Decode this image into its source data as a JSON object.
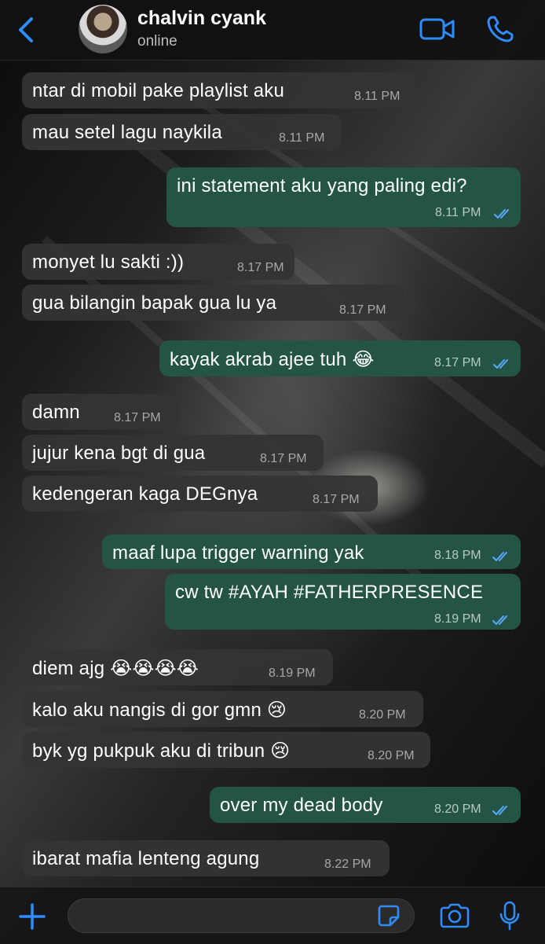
{
  "header": {
    "contact_name": "chalvin cyank",
    "status": "online"
  },
  "colors": {
    "accent": "#2f8cff",
    "incoming_bubble": "#343434",
    "outgoing_bubble": "#235446",
    "read_ticks": "#5aa9ff"
  },
  "messages": [
    {
      "dir": "in",
      "text": "ntar di mobil pake playlist aku",
      "time": "8.11 PM"
    },
    {
      "dir": "in",
      "text": "mau setel lagu naykila",
      "time": "8.11 PM"
    },
    {
      "dir": "out",
      "text": "ini statement aku yang paling edi?",
      "time": "8.11 PM",
      "status": "read"
    },
    {
      "dir": "in",
      "text": "monyet lu sakti :))",
      "time": "8.17 PM"
    },
    {
      "dir": "in",
      "text": "gua bilangin bapak gua lu ya",
      "time": "8.17 PM"
    },
    {
      "dir": "out",
      "text": "kayak akrab ajee tuh 😂",
      "time": "8.17 PM",
      "status": "read"
    },
    {
      "dir": "in",
      "text": "damn",
      "time": "8.17 PM"
    },
    {
      "dir": "in",
      "text": "jujur kena bgt di gua",
      "time": "8.17 PM"
    },
    {
      "dir": "in",
      "text": "kedengeran kaga DEGnya",
      "time": "8.17 PM"
    },
    {
      "dir": "out",
      "text": "maaf lupa trigger warning yak",
      "time": "8.18 PM",
      "status": "read"
    },
    {
      "dir": "out",
      "text": "cw tw #AYAH #FATHERPRESENCE",
      "time": "8.19 PM",
      "status": "read"
    },
    {
      "dir": "in",
      "text": "diem ajg 😭😭😭😭",
      "time": "8.19 PM"
    },
    {
      "dir": "in",
      "text": "kalo aku nangis di gor gmn 😢",
      "time": "8.20 PM"
    },
    {
      "dir": "in",
      "text": "byk yg pukpuk aku di tribun 😢",
      "time": "8.20 PM"
    },
    {
      "dir": "out",
      "text": "over my dead body",
      "time": "8.20 PM",
      "status": "read"
    },
    {
      "dir": "in",
      "text": "ibarat mafia lenteng agung",
      "time": "8.22 PM"
    }
  ],
  "composer": {
    "input_value": "",
    "icons": [
      "plus-icon",
      "sticker-icon",
      "camera-icon",
      "mic-icon"
    ]
  }
}
